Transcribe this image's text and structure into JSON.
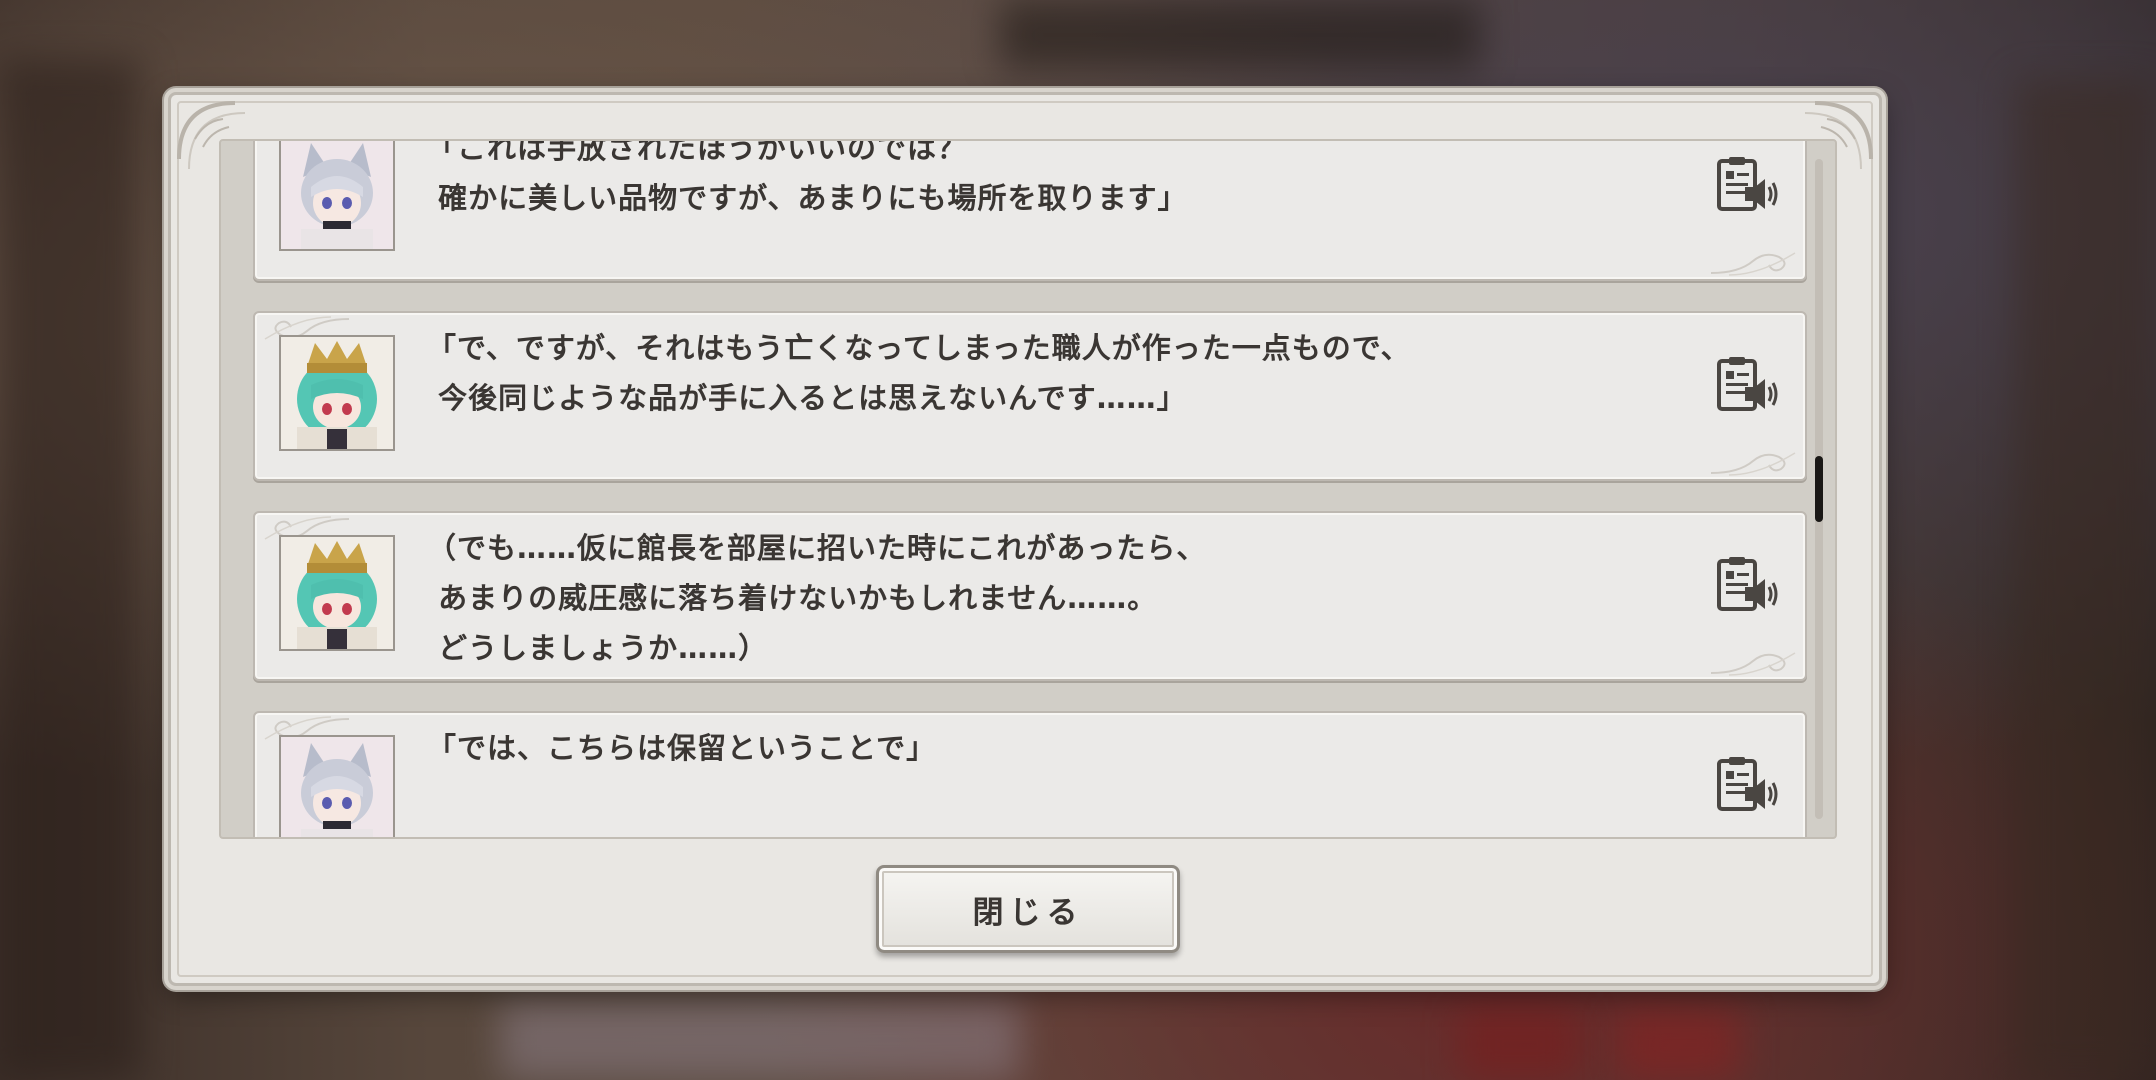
{
  "log": {
    "entries": [
      {
        "speaker_icon": "cat-eared-silver-hair-avatar",
        "text": "「これは手放されたほうがいいのでは？\n 確かに美しい品物ですが、あまりにも場所を取ります」"
      },
      {
        "speaker_icon": "crowned-green-hair-avatar",
        "text": "「で、ですが、それはもう亡くなってしまった職人が作った一点もので、\n 今後同じような品が手に入るとは思えないんです……」"
      },
      {
        "speaker_icon": "crowned-green-hair-avatar",
        "text": "（でも……仮に館長を部屋に招いた時にこれがあったら、\n あまりの威圧感に落ち着けないかもしれません……。\n どうしましょうか……）"
      },
      {
        "speaker_icon": "cat-eared-silver-hair-avatar",
        "text": "「では、こちらは保留ということで」"
      }
    ],
    "voice_icon": "voice-replay-icon",
    "scroll_position": 0.5
  },
  "buttons": {
    "close_label": "閉じる"
  },
  "colors": {
    "panel_bg": "#e9e7e3",
    "entry_bg": "#ebeae8",
    "text": "#3a3633",
    "scroll_thumb": "#1a1816"
  }
}
